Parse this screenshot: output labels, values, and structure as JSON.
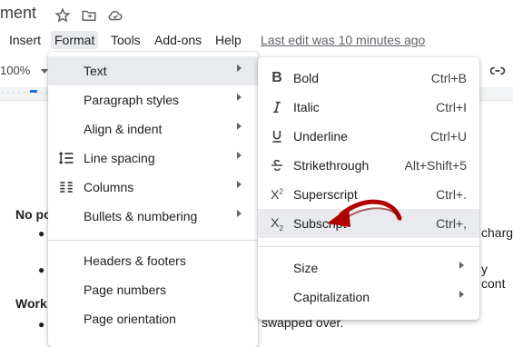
{
  "title_bar": {
    "doc_title": "ment",
    "icons": [
      "star-icon",
      "move-to-folder-icon",
      "cloud-saved-icon"
    ]
  },
  "menubar": {
    "items": [
      "Insert",
      "Format",
      "Tools",
      "Add-ons",
      "Help"
    ],
    "last_edit": "Last edit was 10 minutes ago"
  },
  "toolbar": {
    "zoom": "100%",
    "link_icon": "link-icon"
  },
  "document": {
    "heading1": "No po",
    "line1_tail": "charg",
    "line2_tail": "y cont",
    "heading2": "Work",
    "line3_tail": "swapped over.",
    "bullet": "●"
  },
  "format_menu": {
    "items": [
      {
        "label": "Text",
        "icon": "",
        "submenu": true
      },
      {
        "label": "Paragraph styles",
        "icon": "",
        "submenu": true
      },
      {
        "label": "Align & indent",
        "icon": "",
        "submenu": true
      },
      {
        "label": "Line spacing",
        "icon": "line-spacing-icon",
        "submenu": true
      },
      {
        "label": "Columns",
        "icon": "columns-icon",
        "submenu": true
      },
      {
        "label": "Bullets & numbering",
        "icon": "",
        "submenu": true
      },
      {
        "label": "Headers & footers",
        "icon": "",
        "submenu": false
      },
      {
        "label": "Page numbers",
        "icon": "",
        "submenu": false
      },
      {
        "label": "Page orientation",
        "icon": "",
        "submenu": false
      }
    ]
  },
  "text_submenu": {
    "items": [
      {
        "label": "Bold",
        "shortcut": "Ctrl+B",
        "icon": "bold-icon"
      },
      {
        "label": "Italic",
        "shortcut": "Ctrl+I",
        "icon": "italic-icon"
      },
      {
        "label": "Underline",
        "shortcut": "Ctrl+U",
        "icon": "underline-icon"
      },
      {
        "label": "Strikethrough",
        "shortcut": "Alt+Shift+5",
        "icon": "strikethrough-icon"
      },
      {
        "label": "Superscript",
        "shortcut": "Ctrl+.",
        "icon": "superscript-icon"
      },
      {
        "label": "Subscript",
        "shortcut": "Ctrl+,",
        "icon": "subscript-icon"
      },
      {
        "label": "Size",
        "shortcut": "",
        "icon": ""
      },
      {
        "label": "Capitalization",
        "shortcut": "",
        "icon": ""
      }
    ]
  },
  "colors": {
    "highlight": "#e8eaed",
    "arrow": "#b00000",
    "ruler_accent": "#1a73e8"
  }
}
